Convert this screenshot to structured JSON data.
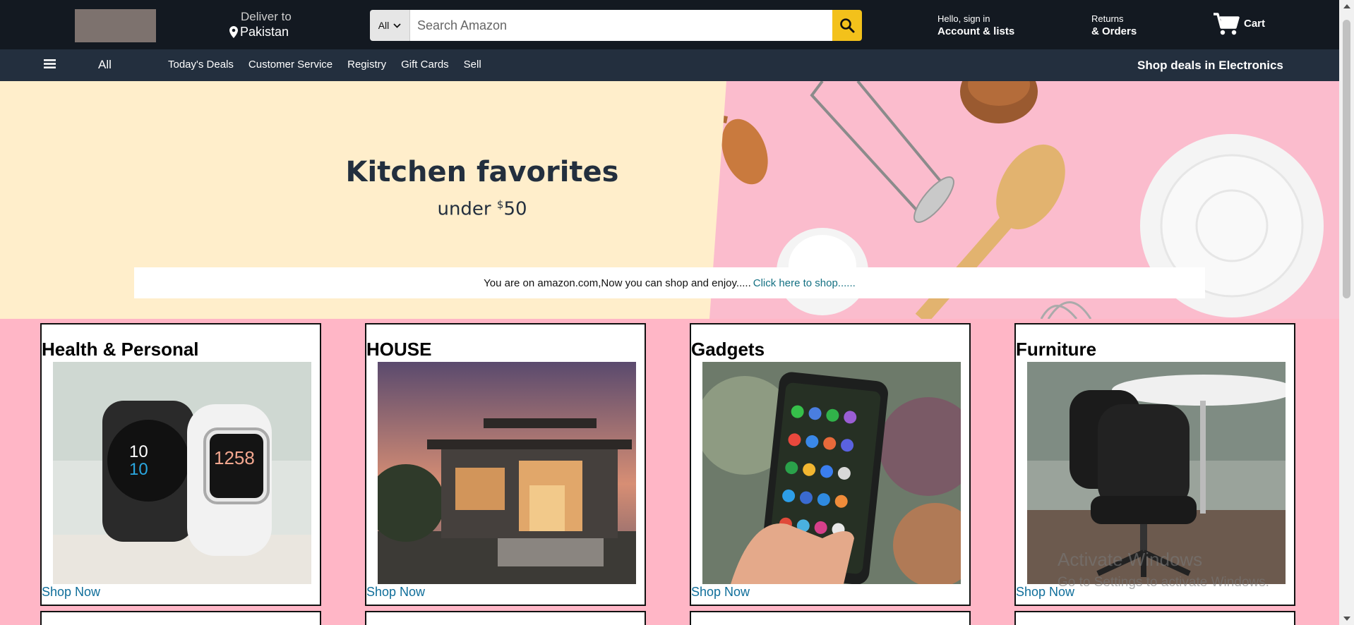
{
  "header": {
    "deliver_label": "Deliver to",
    "deliver_location": "Pakistan",
    "search_category": "All",
    "search_placeholder": "Search Amazon",
    "account_greeting": "Hello, sign in",
    "account_label": "Account & lists",
    "returns_label": "Returns",
    "orders_label": "& Orders",
    "cart_label": "Cart"
  },
  "subnav": {
    "all_label": "All",
    "links": [
      "Today's Deals",
      "Customer Service",
      "Registry",
      "Gift Cards",
      "Sell"
    ],
    "promo": "Shop deals in Electronics"
  },
  "hero": {
    "title": "Kitchen favorites",
    "subtitle_prefix": "under ",
    "subtitle_currency": "$",
    "subtitle_amount": "50"
  },
  "notice": {
    "text": "You are on amazon.com,Now you can shop and enjoy.....",
    "link": "Click here to shop......"
  },
  "cards": [
    {
      "title": "Health & Personal",
      "link": "Shop Now"
    },
    {
      "title": "HOUSE",
      "link": "Shop Now"
    },
    {
      "title": "Gadgets",
      "link": "Shop Now"
    },
    {
      "title": "Furniture",
      "link": "Shop Now"
    }
  ],
  "watermark": {
    "line1": "Activate Windows",
    "line2": "Go to Settings to activate Windows."
  },
  "colors": {
    "topnav": "#131921",
    "subnav": "#232f3e",
    "search_button": "#f3c11b",
    "hero_left": "#ffeecb",
    "hero_right": "#fbbccd",
    "page_bg": "#ffb6c6",
    "link": "#0f6e9a"
  }
}
